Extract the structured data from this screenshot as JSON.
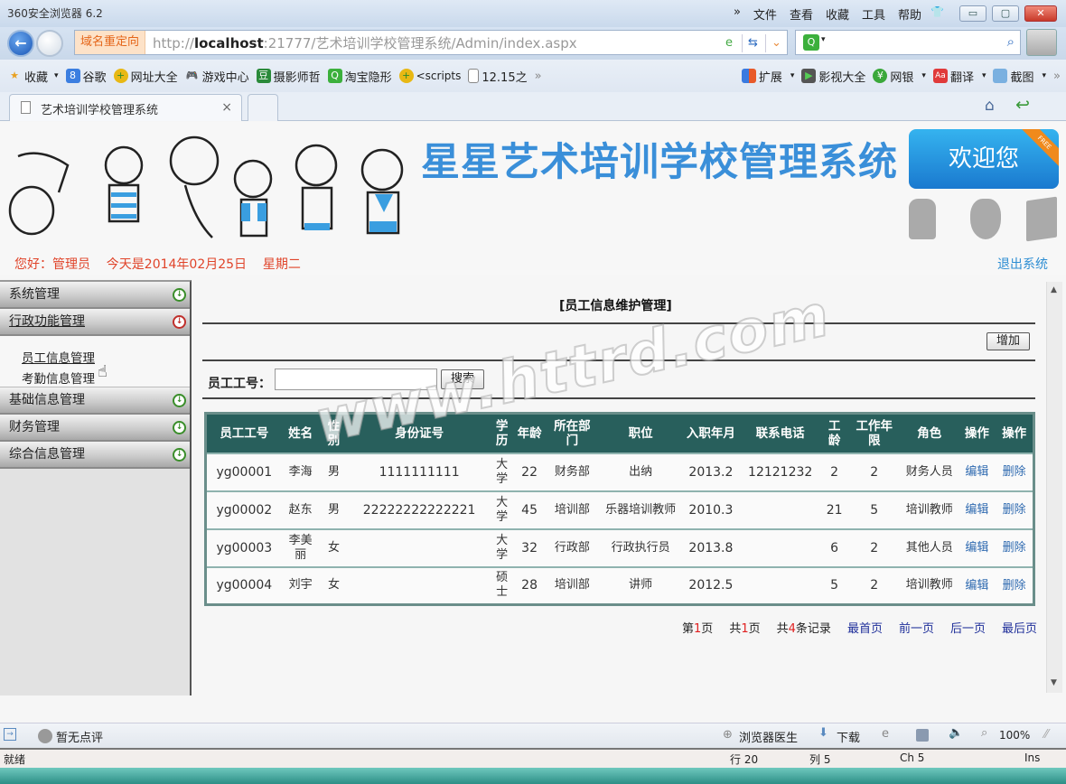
{
  "browser": {
    "window_title": "360安全浏览器 6.2",
    "menu": [
      "»",
      "文件",
      "查看",
      "收藏",
      "工具",
      "帮助"
    ],
    "window_buttons": {
      "minimize": "▭",
      "maximize": "▢",
      "close": "✕"
    },
    "address": {
      "redirect_label": "域名重定向",
      "url_prefix": "http://",
      "url_host": "localhost",
      "url_rest": ":21777/艺术培训学校管理系统/Admin/index.aspx"
    },
    "search_placeholder": "",
    "favorites": [
      {
        "label": "收藏",
        "icon": "star-icon",
        "dropdown": true
      },
      {
        "label": "谷歌",
        "icon": "google-icon"
      },
      {
        "label": "网址大全",
        "icon": "plus-circle-icon"
      },
      {
        "label": "游戏中心",
        "icon": "gamepad-icon"
      },
      {
        "label": "摄影师哲",
        "icon": "douban-icon"
      },
      {
        "label": "淘宝隐形",
        "icon": "search-green-icon"
      },
      {
        "label": "<scripts",
        "icon": "plus-circle-icon"
      },
      {
        "label": "12.15之",
        "icon": "page-icon"
      },
      {
        "label": "»",
        "icon": ""
      }
    ],
    "favorites_right": [
      {
        "label": "扩展",
        "icon": "extension-icon",
        "dropdown": true
      },
      {
        "label": "影视大全",
        "icon": "video-icon"
      },
      {
        "label": "网银",
        "icon": "bank-icon",
        "dropdown": true
      },
      {
        "label": "翻译",
        "icon": "translate-icon",
        "dropdown": true
      },
      {
        "label": "截图",
        "icon": "screenshot-icon",
        "dropdown": true
      },
      {
        "label": "»",
        "icon": ""
      }
    ],
    "tab": {
      "title": "艺术培训学校管理系统",
      "close": "×"
    }
  },
  "header": {
    "system_title": "星星艺术培训学校管理系统",
    "welcome": "欢迎您",
    "free_ribbon": "FREE",
    "greeting": "您好：管理员    今天是2014年02月25日    星期二",
    "logout": "退出系统"
  },
  "sidebar": {
    "sections": [
      {
        "label": "系统管理",
        "expanded": false
      },
      {
        "label": "行政功能管理",
        "expanded": true,
        "items": [
          "员工信息管理",
          "考勤信息管理"
        ]
      },
      {
        "label": "基础信息管理",
        "expanded": false
      },
      {
        "label": "财务管理",
        "expanded": false
      },
      {
        "label": "综合信息管理",
        "expanded": false
      }
    ]
  },
  "main": {
    "title": "[员工信息维护管理]",
    "add_button": "增加",
    "search_label": "员工工号：",
    "search_value": "",
    "search_button": "搜索",
    "watermark": "www.httrd.com",
    "table": {
      "headers": [
        "员工工号",
        "姓名",
        "性别",
        "身份证号",
        "学历",
        "年龄",
        "所在部门",
        "职位",
        "入职年月",
        "联系电话",
        "工龄",
        "工作年限",
        "角色",
        "操作",
        "操作"
      ],
      "rows": [
        [
          "yg00001",
          "李海",
          "男",
          "1111111111",
          "大学",
          "22",
          "财务部",
          "出纳",
          "2013.2",
          "12121232",
          "2",
          "2",
          "财务人员",
          "编辑",
          "删除"
        ],
        [
          "yg00002",
          "赵东",
          "男",
          "22222222222221",
          "大学",
          "45",
          "培训部",
          "乐器培训教师",
          "2010.3",
          "",
          "21",
          "5",
          "培训教师",
          "编辑",
          "删除"
        ],
        [
          "yg00003",
          "李美丽",
          "女",
          "",
          "大学",
          "32",
          "行政部",
          "行政执行员",
          "2013.8",
          "",
          "6",
          "2",
          "其他人员",
          "编辑",
          "删除"
        ],
        [
          "yg00004",
          "刘宇",
          "女",
          "",
          "硕士",
          "28",
          "培训部",
          "讲师",
          "2012.5",
          "",
          "5",
          "2",
          "培训教师",
          "编辑",
          "删除"
        ]
      ]
    },
    "pager": {
      "current_prefix": "第",
      "current": "1",
      "current_suffix": "页",
      "total_prefix": "共",
      "total_pages": "1",
      "total_suffix": "页",
      "records_prefix": "共",
      "records": "4",
      "records_suffix": "条记录",
      "first": "最首页",
      "prev": "前一页",
      "next": "后一页",
      "last": "最后页"
    }
  },
  "bottom": {
    "comment": "暂无点评",
    "doctor": "浏览器医生",
    "download": "下载",
    "zoom": "100%"
  },
  "status": {
    "ready": "就绪",
    "line": "行 20",
    "col": "列 5",
    "ch": "Ch 5",
    "mode": "Ins"
  }
}
